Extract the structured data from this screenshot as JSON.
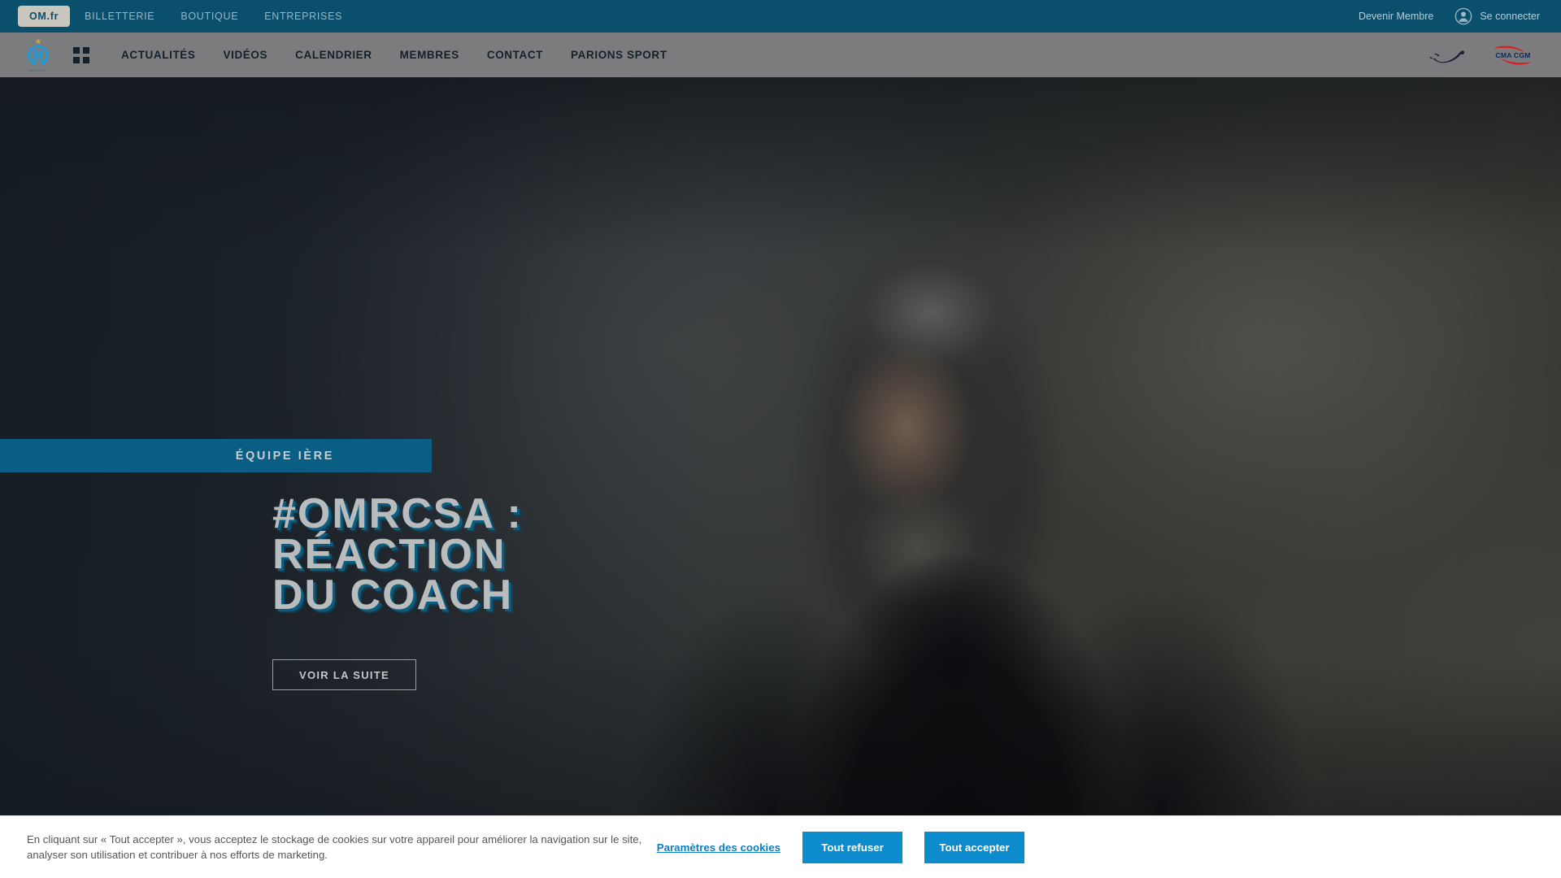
{
  "topbar": {
    "links": [
      {
        "label": "OM.fr",
        "active": true
      },
      {
        "label": "BILLETTERIE",
        "active": false
      },
      {
        "label": "BOUTIQUE",
        "active": false
      },
      {
        "label": "ENTREPRISES",
        "active": false
      }
    ],
    "become_member": "Devenir Membre",
    "login": "Se connecter",
    "login_icon": "user-avatar-icon",
    "background_color": "#0a4f6b",
    "active_tab_background": "#c9c6be"
  },
  "mainnav": {
    "logo_icon": "om-crest-logo",
    "grid_icon": "grid-menu-icon",
    "items": [
      {
        "label": "ACTUALITÉS"
      },
      {
        "label": "VIDÉOS"
      },
      {
        "label": "CALENDRIER"
      },
      {
        "label": "MEMBRES"
      },
      {
        "label": "CONTACT"
      },
      {
        "label": "PARIONS SPORT"
      }
    ],
    "sponsors": [
      {
        "name": "puma-logo",
        "label": "PUMA"
      },
      {
        "name": "cma-cgm-logo",
        "label": "CMA CGM"
      }
    ],
    "background_color": "#7c7c7e"
  },
  "hero": {
    "badge": "ÉQUIPE IÈRE",
    "badge_color": "#0a5e84",
    "title_line1": "#OMRCSA :",
    "title_line2": "RÉACTION",
    "title_line3": "DU COACH",
    "title_full": "#OMRCSA :\nRÉACTION\nDU COACH",
    "cta": "VOIR LA SUITE",
    "image_alt": "Portrait du coach en survêtement sombre sur fond de stade flou",
    "title_color": "#b9bcbd",
    "title_shadow_color": "#0c6084"
  },
  "cookie_banner": {
    "text": "En cliquant sur « Tout accepter », vous acceptez le stockage de cookies sur votre appareil pour améliorer la navigation sur le site, analyser son utilisation et contribuer à nos efforts de marketing.",
    "settings_link": "Paramètres des cookies",
    "reject_all": "Tout refuser",
    "accept_all": "Tout accepter",
    "button_color": "#0c8ccd",
    "link_color": "#0c7fc4"
  }
}
